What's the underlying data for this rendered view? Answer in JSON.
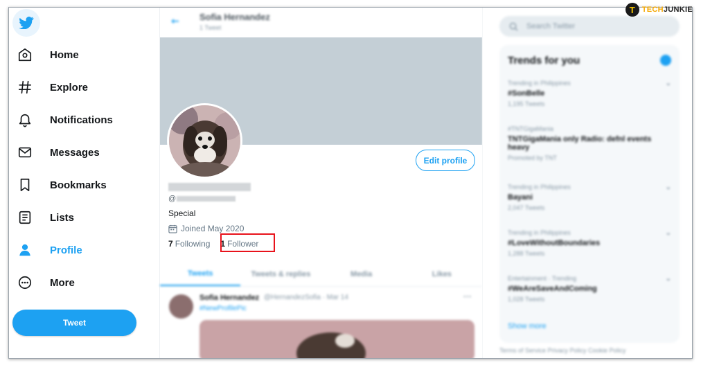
{
  "watermark": {
    "badge": "T",
    "part1": "TECH",
    "part2": "JUNKIE"
  },
  "sidebar": {
    "logo_icon": "twitter-bird-icon",
    "items": [
      {
        "label": "Home",
        "icon": "home-icon"
      },
      {
        "label": "Explore",
        "icon": "hashtag-icon"
      },
      {
        "label": "Notifications",
        "icon": "bell-icon"
      },
      {
        "label": "Messages",
        "icon": "envelope-icon"
      },
      {
        "label": "Bookmarks",
        "icon": "bookmark-icon"
      },
      {
        "label": "Lists",
        "icon": "list-icon"
      },
      {
        "label": "Profile",
        "icon": "person-icon",
        "active": true
      },
      {
        "label": "More",
        "icon": "more-circle-icon"
      }
    ],
    "tweet_button": "Tweet"
  },
  "profile": {
    "header_name": "Sofia Hernandez",
    "header_tweets": "1 Tweet",
    "edit_button": "Edit profile",
    "handle_prefix": "@",
    "bio": "Special",
    "joined": "Joined May 2020",
    "following_count": "7",
    "following_label": "Following",
    "follower_count": "1",
    "follower_label": "Follower",
    "tabs": [
      "Tweets",
      "Tweets & replies",
      "Media",
      "Likes"
    ]
  },
  "tweet": {
    "name": "Sofia Hernandez",
    "meta": "@HernandezSofia · Mar 14",
    "text": "#NewProfilePic",
    "more": "···"
  },
  "right": {
    "search_placeholder": "Search Twitter",
    "trends_title": "Trends for you",
    "trends": [
      {
        "context": "Trending in Philippines",
        "name": "#SonBelle",
        "count": "1,195 Tweets"
      },
      {
        "context": "#TNTGigaMania",
        "name": "TNTGigaMania only Radio: defnl events heavy",
        "count": "Promoted by TNT"
      },
      {
        "context": "Trending in Philippines",
        "name": "Bayani",
        "count": "2,047 Tweets"
      },
      {
        "context": "Trending in Philippines",
        "name": "#LoveWithoutBoundaries",
        "count": "1,288 Tweets"
      },
      {
        "context": "Entertainment · Trending",
        "name": "#WeAreSaveAndComing",
        "count": "1,028 Tweets"
      }
    ],
    "show_more": "Show more",
    "footer": "Terms of Service  Privacy Policy  Cookie Policy"
  },
  "colors": {
    "accent": "#1da1f2",
    "highlight": "#e8121b",
    "banner": "#c4cfd6"
  }
}
